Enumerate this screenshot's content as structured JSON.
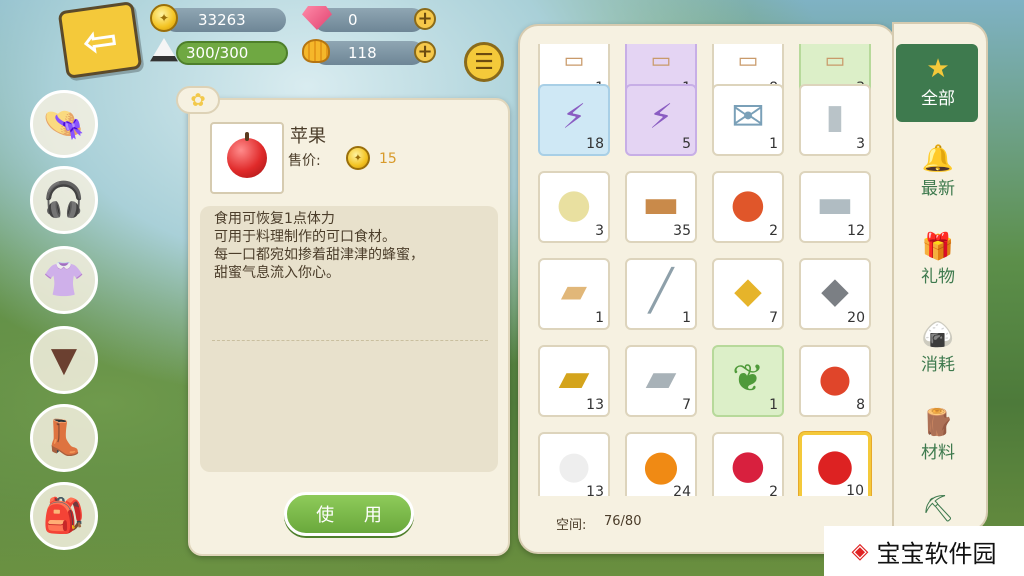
{
  "header": {
    "back_icon": "back-arrow-icon",
    "gold": "33263",
    "gems": "0",
    "stamina": "300/300",
    "shells": "118",
    "plus": "+",
    "menu_icon": "list-menu-icon"
  },
  "sidebar": [
    {
      "name": "hat",
      "icon": "hat-icon"
    },
    {
      "name": "headphones",
      "icon": "headphones-icon"
    },
    {
      "name": "top",
      "icon": "sailor-shirt-icon"
    },
    {
      "name": "skirt",
      "icon": "skirt-icon"
    },
    {
      "name": "shoes",
      "icon": "boots-icon"
    },
    {
      "name": "bag",
      "icon": "backpack-icon"
    }
  ],
  "detail": {
    "name": "苹果",
    "price_label": "售价:",
    "price": "15",
    "description": [
      "食用可恢复1点体力",
      "可用于料理制作的可口食材。",
      "每一口都宛如掺着甜津津的蜂蜜，",
      "甜蜜气息流入你心。"
    ],
    "use_button": "使 用"
  },
  "inventory": {
    "space_label": "空间:",
    "space_value": "76/80",
    "items": [
      {
        "count": "1",
        "bg": "white",
        "art": "partial"
      },
      {
        "count": "1",
        "bg": "purple",
        "art": "partial"
      },
      {
        "count": "8",
        "bg": "white",
        "art": "partial"
      },
      {
        "count": "3",
        "bg": "green",
        "art": "partial"
      },
      {
        "count": "18",
        "bg": "blue",
        "art": "lightning-bag"
      },
      {
        "count": "5",
        "bg": "purple",
        "art": "lightning-bag"
      },
      {
        "count": "1",
        "bg": "white",
        "art": "letter"
      },
      {
        "count": "3",
        "bg": "white",
        "art": "birch-log"
      },
      {
        "count": "3",
        "bg": "white",
        "art": "sponge"
      },
      {
        "count": "35",
        "bg": "white",
        "art": "wood-log"
      },
      {
        "count": "2",
        "bg": "white",
        "art": "amber"
      },
      {
        "count": "12",
        "bg": "white",
        "art": "birch-plank"
      },
      {
        "count": "1",
        "bg": "white",
        "art": "wood-plank"
      },
      {
        "count": "1",
        "bg": "white",
        "art": "stick"
      },
      {
        "count": "7",
        "bg": "white",
        "art": "gold-ore"
      },
      {
        "count": "20",
        "bg": "white",
        "art": "stone"
      },
      {
        "count": "13",
        "bg": "white",
        "art": "gold-ingot"
      },
      {
        "count": "7",
        "bg": "white",
        "art": "silver-ingot"
      },
      {
        "count": "1",
        "bg": "green",
        "art": "herb"
      },
      {
        "count": "8",
        "bg": "white",
        "art": "tomato"
      },
      {
        "count": "13",
        "bg": "white",
        "art": "turnip"
      },
      {
        "count": "24",
        "bg": "white",
        "art": "orange"
      },
      {
        "count": "2",
        "bg": "white",
        "art": "raspberry"
      },
      {
        "count": "10",
        "bg": "selected",
        "art": "apple"
      }
    ]
  },
  "tabs": [
    {
      "label": "全部",
      "icon": "star-icon",
      "active": true
    },
    {
      "label": "最新",
      "icon": "bell-icon",
      "active": false
    },
    {
      "label": "礼物",
      "icon": "gift-icon",
      "active": false
    },
    {
      "label": "消耗",
      "icon": "rice-ball-icon",
      "active": false
    },
    {
      "label": "材料",
      "icon": "log-icon",
      "active": false
    },
    {
      "label": "",
      "icon": "shovel-icon",
      "active": false
    }
  ],
  "watermark": "宝宝软件园"
}
